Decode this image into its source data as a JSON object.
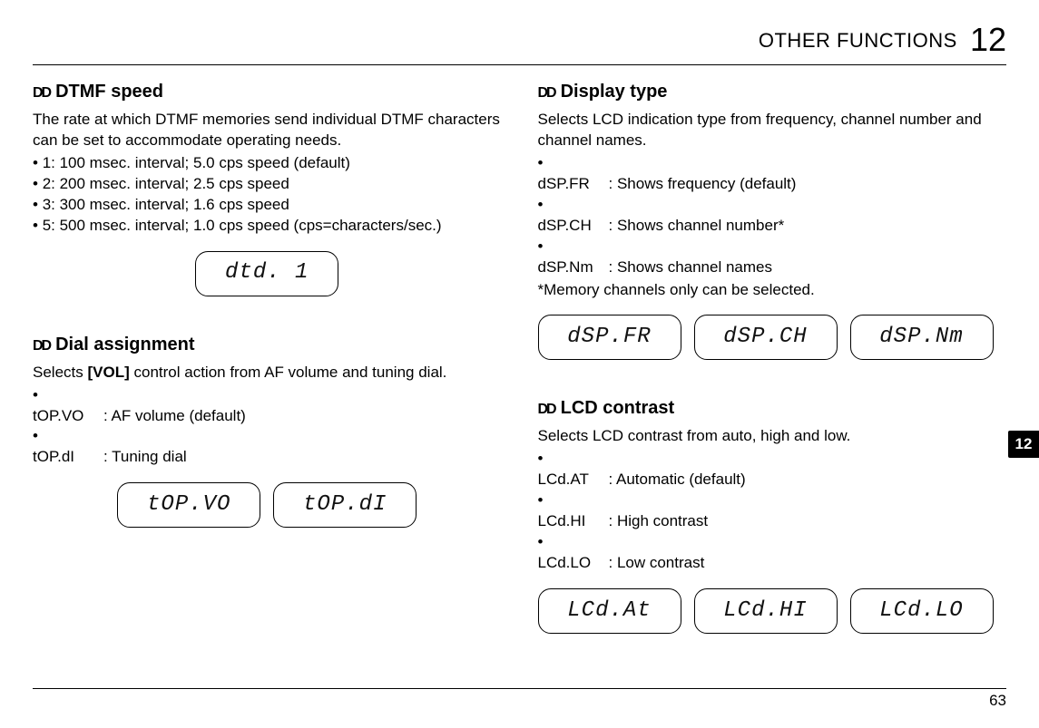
{
  "header": {
    "title": "OTHER FUNCTIONS",
    "chapter": "12"
  },
  "sidetab": "12",
  "page_number": "63",
  "diamond": "DD",
  "left": {
    "dtmf": {
      "heading": "DTMF speed",
      "intro": "The rate at which DTMF memories send individual DTMF characters can be set to accommodate operating needs.",
      "bullets": [
        "1: 100 msec. interval; 5.0 cps speed (default)",
        "2: 200 msec. interval; 2.5 cps speed",
        "3: 300 msec. interval; 1.6 cps speed",
        "5: 500 msec. interval; 1.0 cps speed  (cps=characters/sec.)"
      ],
      "lcd": [
        "dtd.  1"
      ]
    },
    "dial": {
      "heading": "Dial assignment",
      "intro_pre": "Selects ",
      "intro_bold": "[VOL]",
      "intro_post": " control action from AF volume and tuning dial.",
      "options": [
        {
          "key": "tOP.VO",
          "desc": ": AF volume (default)"
        },
        {
          "key": "tOP.dI",
          "desc": ": Tuning dial"
        }
      ],
      "lcd": [
        "tOP.VO",
        "tOP.dI"
      ]
    }
  },
  "right": {
    "display": {
      "heading": "Display type",
      "intro": "Selects LCD indication type from frequency, channel number and channel names.",
      "options": [
        {
          "key": "dSP.FR",
          "desc": ": Shows frequency (default)"
        },
        {
          "key": "dSP.CH",
          "desc": ": Shows channel number*"
        },
        {
          "key": "dSP.Nm",
          "desc": ": Shows channel names"
        }
      ],
      "note": "*Memory channels only can be selected.",
      "lcd": [
        "dSP.FR",
        "dSP.CH",
        "dSP.Nm"
      ]
    },
    "contrast": {
      "heading": "LCD contrast",
      "intro": "Selects LCD contrast from auto, high and low.",
      "options": [
        {
          "key": "LCd.AT",
          "desc": ": Automatic (default)"
        },
        {
          "key": "LCd.HI",
          "desc": ": High contrast"
        },
        {
          "key": "LCd.LO",
          "desc": ": Low contrast"
        }
      ],
      "lcd": [
        "LCd.At",
        "LCd.HI",
        "LCd.LO"
      ]
    }
  }
}
